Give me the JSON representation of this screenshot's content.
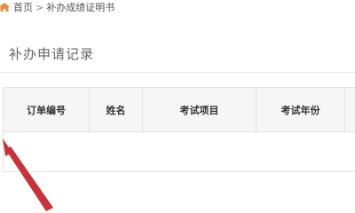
{
  "breadcrumb": {
    "home_icon": "home-icon",
    "home_label": "首页",
    "separator": ">",
    "current_label": "补办成绩证明书"
  },
  "section": {
    "title": "补办申请记录"
  },
  "table": {
    "columns": [
      "订单编号",
      "姓名",
      "考试项目",
      "考试年份",
      ""
    ],
    "rows": []
  },
  "colors": {
    "home_icon": "#f0883a",
    "annotation_arrow": "#c8323a",
    "header_bg": "#f6f6f6",
    "border": "#e2e2e2"
  }
}
